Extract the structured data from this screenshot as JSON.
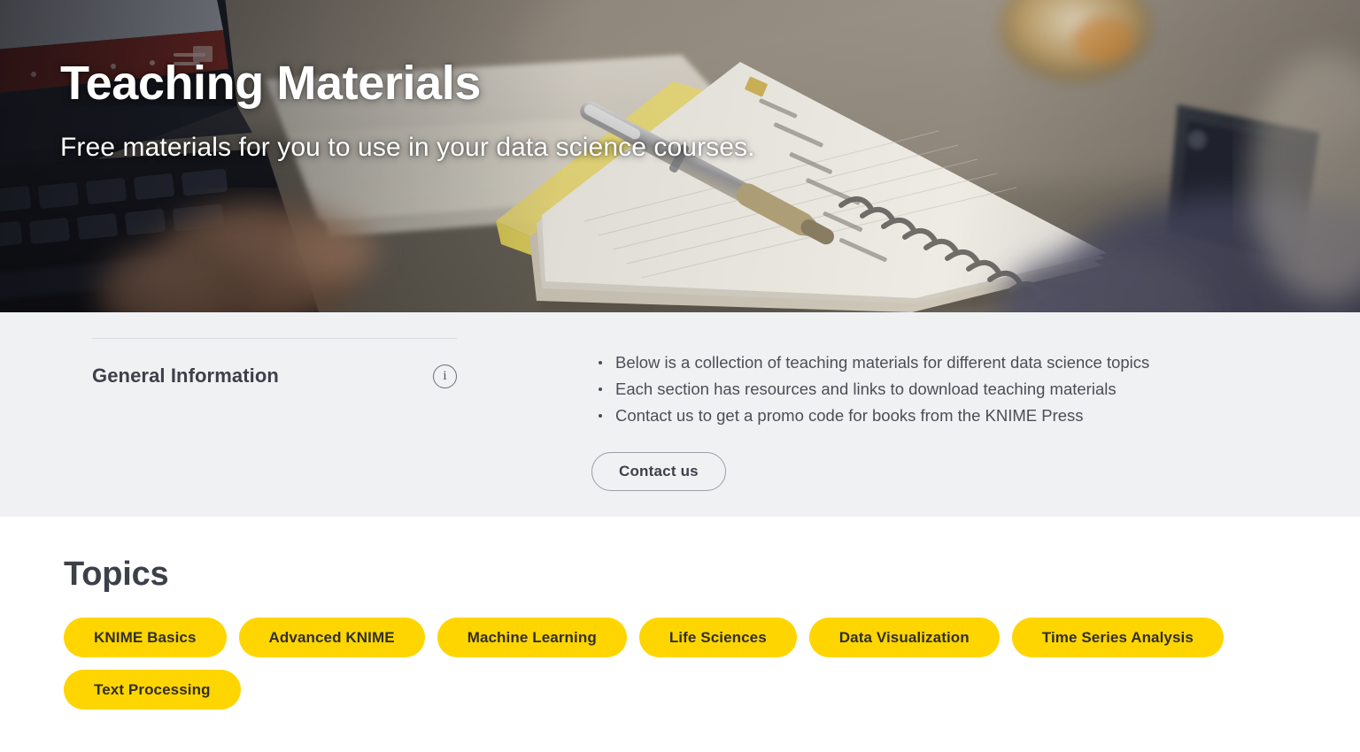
{
  "hero": {
    "title": "Teaching Materials",
    "subtitle": "Free materials for you to use in your data science courses.",
    "image_alt": "Desk with laptop, spiral notebook and pen"
  },
  "general_information": {
    "heading": "General Information",
    "info_icon": "info-circle-icon",
    "bullets": [
      "Below is a collection of teaching materials for different data science topics",
      "Each section has resources and links to download teaching materials",
      "Contact us to get a promo code for books from the KNIME Press"
    ],
    "contact_button": "Contact us"
  },
  "topics": {
    "heading": "Topics",
    "tags": [
      "KNIME Basics",
      "Advanced KNIME",
      "Machine Learning",
      "Life Sciences",
      "Data Visualization",
      "Time Series Analysis",
      "Text Processing"
    ]
  },
  "colors": {
    "tag_background": "#ffd500",
    "tag_text": "#2f2f2f",
    "heading_text": "#3c4049",
    "body_text": "#4a4e56",
    "band_background": "#f0f1f3",
    "page_background": "#ffffff"
  }
}
